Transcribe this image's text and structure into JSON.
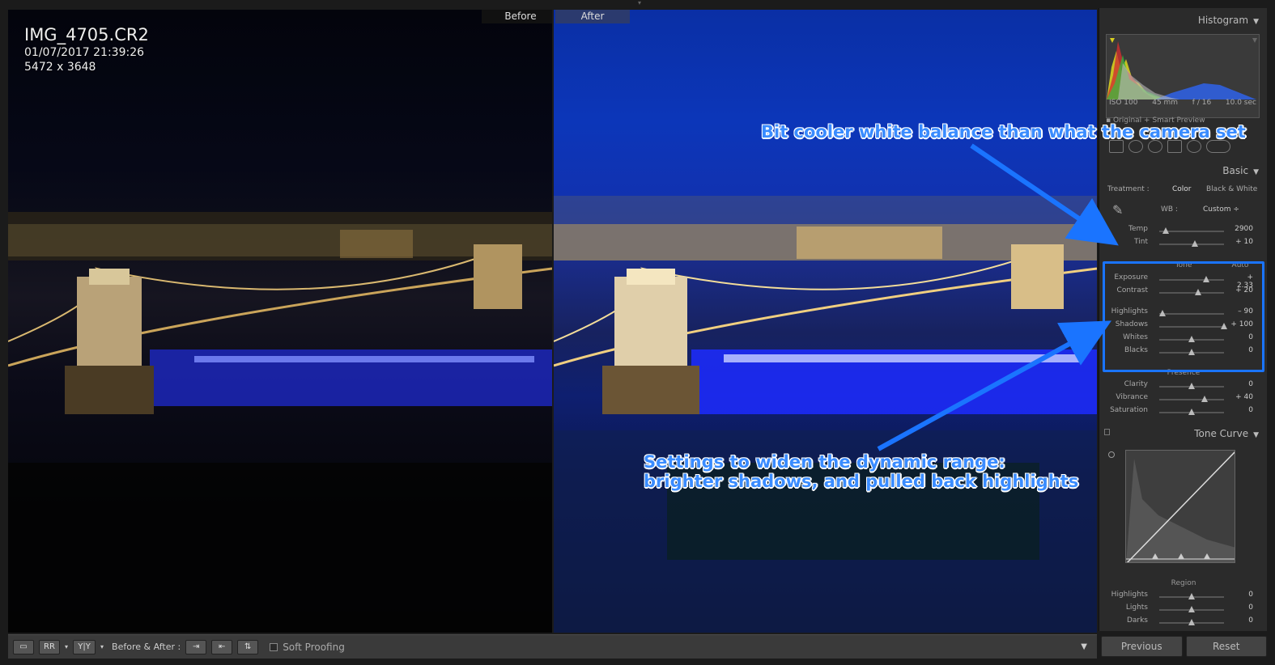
{
  "photo": {
    "filename": "IMG_4705.CR2",
    "datetime": "01/07/2017 21:39:26",
    "dimensions": "5472 x 3648",
    "before_label": "Before",
    "after_label": "After"
  },
  "histogram": {
    "title": "Histogram",
    "iso": "ISO 100",
    "focal": "45 mm",
    "aperture": "f / 16",
    "shutter": "10.0 sec",
    "preview": "Original + Smart Preview"
  },
  "basic": {
    "title": "Basic",
    "treatment_label": "Treatment :",
    "treatment_color": "Color",
    "treatment_bw": "Black & White",
    "wb_label": "WB :",
    "wb_value": "Custom ÷",
    "tone_label": "Tone",
    "tone_auto": "Auto",
    "presence_label": "Presence",
    "sliders": [
      {
        "name": "Temp",
        "value": "2900",
        "pos": 0.1
      },
      {
        "name": "Tint",
        "value": "+ 10",
        "pos": 0.55
      },
      {
        "name": "Exposure",
        "value": "+ 2.33",
        "pos": 0.73
      },
      {
        "name": "Contrast",
        "value": "+ 20",
        "pos": 0.6
      },
      {
        "name": "Highlights",
        "value": "– 90",
        "pos": 0.05
      },
      {
        "name": "Shadows",
        "value": "+ 100",
        "pos": 1.0
      },
      {
        "name": "Whites",
        "value": "0",
        "pos": 0.5
      },
      {
        "name": "Blacks",
        "value": "0",
        "pos": 0.5
      },
      {
        "name": "Clarity",
        "value": "0",
        "pos": 0.5
      },
      {
        "name": "Vibrance",
        "value": "+ 40",
        "pos": 0.7
      },
      {
        "name": "Saturation",
        "value": "0",
        "pos": 0.5
      }
    ]
  },
  "tone_curve": {
    "title": "Tone Curve",
    "region_label": "Region",
    "sliders": [
      {
        "name": "Highlights",
        "value": "0"
      },
      {
        "name": "Lights",
        "value": "0"
      },
      {
        "name": "Darks",
        "value": "0"
      }
    ]
  },
  "buttons": {
    "previous": "Previous",
    "reset": "Reset"
  },
  "toolbar": {
    "before_after_label": "Before & After :",
    "yy_label": "Y|Y",
    "soft_proofing": "Soft Proofing"
  },
  "annotations": {
    "wb_note": "Bit cooler white balance than what the camera set",
    "dr_note_line1": "Settings to widen the dynamic range:",
    "dr_note_line2": "brighter shadows, and pulled back highlights"
  },
  "colors": {
    "accent": "#1a74ff",
    "panel": "#2b2b2b"
  }
}
